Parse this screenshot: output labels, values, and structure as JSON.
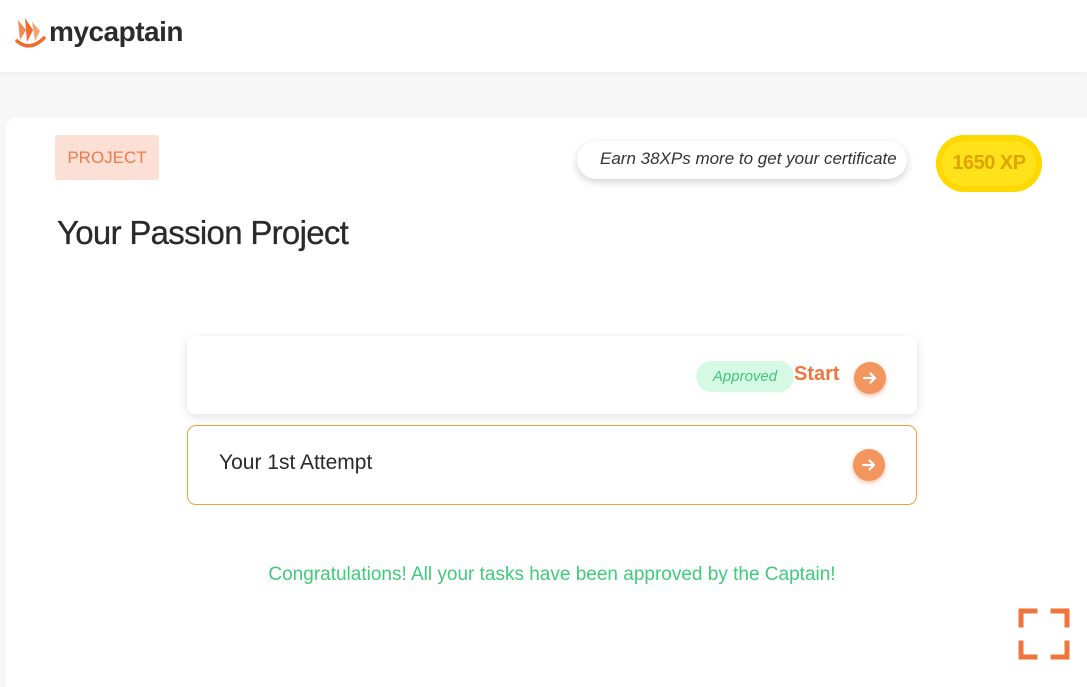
{
  "header": {
    "brand": "mycaptain",
    "logo_icon": "mycaptain-logo-icon"
  },
  "project": {
    "tag": "PROJECT",
    "title": "Your Passion Project",
    "xp_hint": "Earn 38XPs more to get your certificate",
    "xp_badge": "1650 XP"
  },
  "task": {
    "status": "Approved",
    "action_label": "Start",
    "action_icon": "arrow-right-icon"
  },
  "attempt": {
    "label": "Your 1st Attempt",
    "action_icon": "arrow-right-icon"
  },
  "message": "Congratulations! All your tasks have been approved by the Captain!",
  "controls": {
    "fullscreen_icon": "fullscreen-icon"
  },
  "colors": {
    "accent_orange": "#f0743c",
    "approved_green": "#3fc678",
    "xp_yellow": "#ffe21a",
    "tag_bg": "#fde0d5"
  }
}
